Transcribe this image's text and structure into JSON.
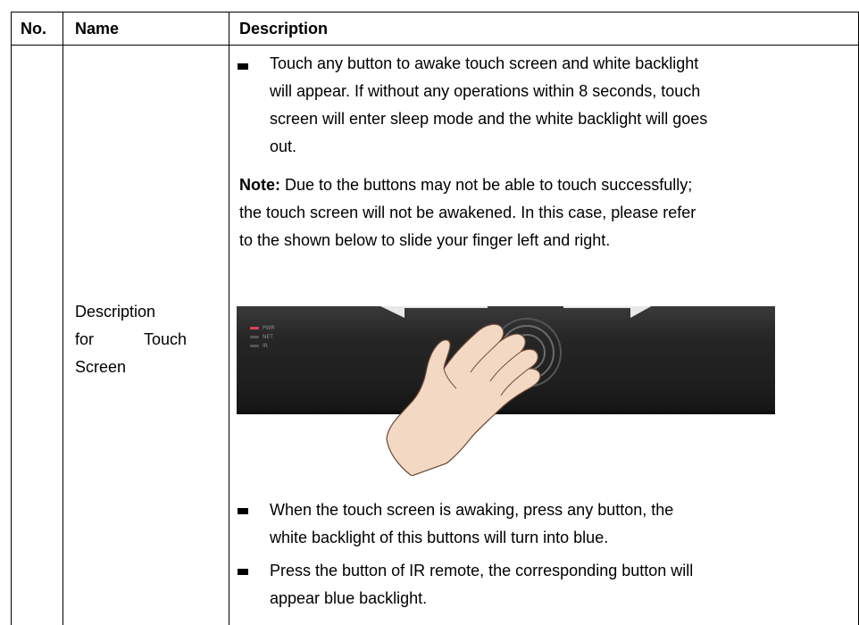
{
  "header": {
    "no": "No.",
    "name": "Name",
    "description": "Description"
  },
  "row": {
    "name_line1": "Description",
    "name_line2a": "for",
    "name_line2b": "Touch",
    "name_line3": "Screen",
    "bullet1_lines": [
      "Touch any button to awake touch screen and white backlight",
      "will appear. If without any operations within 8 seconds, touch",
      "screen will enter sleep mode and the white backlight will goes",
      "out."
    ],
    "note_label": "Note:",
    "note_lines": [
      " Due to the buttons may not be able to touch successfully;",
      "the touch screen will not be awakened. In this case, please refer",
      "to the shown below to slide your finger left and right."
    ],
    "figure": {
      "led_labels": [
        "PWR",
        "NET",
        "IR"
      ],
      "led_colors": [
        "#e0405a",
        "#555555",
        "#555555"
      ]
    },
    "bullet2_lines": [
      "When the touch screen is awaking, press any button, the",
      "white backlight of this buttons will turn into blue."
    ],
    "bullet3_lines": [
      "Press the button of IR remote, the corresponding button will",
      "appear blue backlight."
    ]
  }
}
